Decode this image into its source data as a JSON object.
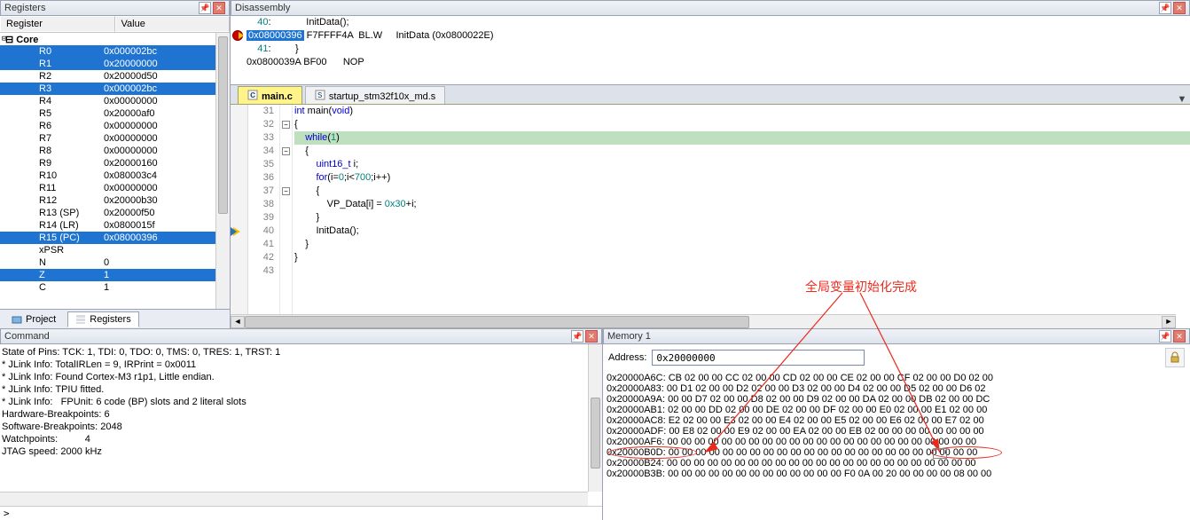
{
  "registers_panel": {
    "title": "Registers",
    "col_register": "Register",
    "col_value": "Value",
    "core_label": "Core",
    "rows": [
      {
        "n": "R0",
        "v": "0x000002bc",
        "sel": true
      },
      {
        "n": "R1",
        "v": "0x20000000",
        "sel": true
      },
      {
        "n": "R2",
        "v": "0x20000d50",
        "sel": false
      },
      {
        "n": "R3",
        "v": "0x000002bc",
        "sel": true
      },
      {
        "n": "R4",
        "v": "0x00000000",
        "sel": false
      },
      {
        "n": "R5",
        "v": "0x20000af0",
        "sel": false
      },
      {
        "n": "R6",
        "v": "0x00000000",
        "sel": false
      },
      {
        "n": "R7",
        "v": "0x00000000",
        "sel": false
      },
      {
        "n": "R8",
        "v": "0x00000000",
        "sel": false
      },
      {
        "n": "R9",
        "v": "0x20000160",
        "sel": false
      },
      {
        "n": "R10",
        "v": "0x080003c4",
        "sel": false
      },
      {
        "n": "R11",
        "v": "0x00000000",
        "sel": false
      },
      {
        "n": "R12",
        "v": "0x20000b30",
        "sel": false
      },
      {
        "n": "R13 (SP)",
        "v": "0x20000f50",
        "sel": false
      },
      {
        "n": "R14 (LR)",
        "v": "0x0800015f",
        "sel": false
      },
      {
        "n": "R15 (PC)",
        "v": "0x08000396",
        "sel": true
      },
      {
        "n": "xPSR",
        "v": "",
        "sel": false
      },
      {
        "n": "N",
        "v": "0",
        "sel": false
      },
      {
        "n": "Z",
        "v": "1",
        "sel": true
      },
      {
        "n": "C",
        "v": "1",
        "sel": false
      }
    ],
    "tabs": {
      "project": "Project",
      "registers": "Registers"
    }
  },
  "disassembly_panel": {
    "title": "Disassembly",
    "lines": [
      {
        "text": "    40:             InitData();",
        "plain": true
      },
      {
        "text": "0x08000396 F7FFFF4A  BL.W     InitData (0x0800022E)",
        "bp": true,
        "sel": "0x08000396"
      },
      {
        "text": "    41:         }",
        "plain": true
      },
      {
        "text": "0x0800039A BF00      NOP",
        "plain": false
      }
    ]
  },
  "tabs": {
    "main_c": "main.c",
    "startup": "startup_stm32f10x_md.s"
  },
  "editor": {
    "first_line": 31,
    "lines": [
      {
        "n": 31,
        "t": "int main(void)"
      },
      {
        "n": 32,
        "t": "{",
        "fold": "-"
      },
      {
        "n": 33,
        "t": "    while(1)",
        "hl": true
      },
      {
        "n": 34,
        "t": "    {",
        "fold": "-"
      },
      {
        "n": 35,
        "t": "        uint16_t i;"
      },
      {
        "n": 36,
        "t": "        for(i=0;i<700;i++)"
      },
      {
        "n": 37,
        "t": "        {",
        "fold": "-"
      },
      {
        "n": 38,
        "t": "            VP_Data[i] = 0x30+i;"
      },
      {
        "n": 39,
        "t": "        }"
      },
      {
        "n": 40,
        "t": "        InitData();",
        "arrow": true,
        "btri": true
      },
      {
        "n": 41,
        "t": "    }"
      },
      {
        "n": 42,
        "t": "}"
      },
      {
        "n": 43,
        "t": ""
      }
    ]
  },
  "command_panel": {
    "title": "Command",
    "body": "State of Pins: TCK: 1, TDI: 0, TDO: 0, TMS: 0, TRES: 1, TRST: 1\n* JLink Info: TotalIRLen = 9, IRPrint = 0x0011\n* JLink Info: Found Cortex-M3 r1p1, Little endian.\n* JLink Info: TPIU fitted.\n* JLink Info:   FPUnit: 6 code (BP) slots and 2 literal slots\nHardware-Breakpoints: 6\nSoftware-Breakpoints: 2048\nWatchpoints:          4\nJTAG speed: 2000 kHz\n",
    "prompt": ">",
    "input_value": ""
  },
  "memory_panel": {
    "title": "Memory 1",
    "address_label": "Address:",
    "address_value": "0x20000000",
    "rows": [
      {
        "a": "0x20000A6C:",
        "d": "CB 02 00 00 CC 02 00 00 CD 02 00 00 CE 02 00 00 CF 02 00 00 D0 02 00"
      },
      {
        "a": "0x20000A83:",
        "d": "00 D1 02 00 00 D2 02 00 00 D3 02 00 00 D4 02 00 00 D5 02 00 00 D6 02"
      },
      {
        "a": "0x20000A9A:",
        "d": "00 00 D7 02 00 00 D8 02 00 00 D9 02 00 00 DA 02 00 00 DB 02 00 00 DC"
      },
      {
        "a": "0x20000AB1:",
        "d": "02 00 00 DD 02 00 00 DE 02 00 00 DF 02 00 00 E0 02 00 00 E1 02 00 00"
      },
      {
        "a": "0x20000AC8:",
        "d": "E2 02 00 00 E3 02 00 00 E4 02 00 00 E5 02 00 00 E6 02 00 00 E7 02 00"
      },
      {
        "a": "0x20000ADF:",
        "d": "00 E8 02 00 00 E9 02 00 00 EA 02 00 00 EB 02 00 00 00 00 00 00 00 00"
      },
      {
        "a": "0x20000AF6:",
        "d": "00 00 00 00 00 00 00 00 00 00 00 00 00 00 00 00 00 00 00 00 00 00 00"
      },
      {
        "a": "0x20000B0D:",
        "d": "00 00 00 00 00 00 00 00 00 00 00 00 00 00 00 00 00 00 00 00 00 00 00"
      },
      {
        "a": "0x20000B24:",
        "d": "00 00 00 00 00 00 00 00 00 00 00 00 00 00 00 00 00 00 00 00 00 00 00"
      },
      {
        "a": "0x20000B3B:",
        "d": "00 00 00 00 00 00 00 00 00 00 00 00 00 F0 0A 00 20 00 00 00 00 08 00 00"
      }
    ]
  },
  "annotation": {
    "text": "全局变量初始化完成"
  }
}
